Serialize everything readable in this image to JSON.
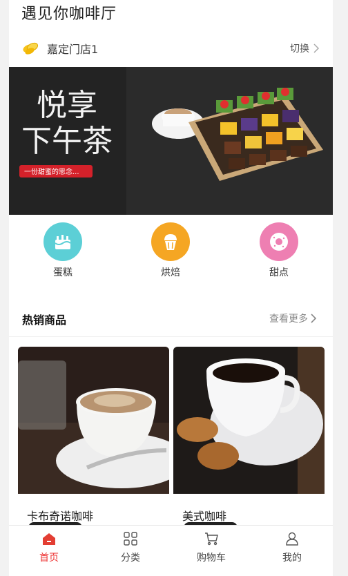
{
  "header": {
    "shop_title": "遇见你咖啡厅"
  },
  "store": {
    "name": "嘉定门店1",
    "switch_label": "切换",
    "icon": "coins-icon"
  },
  "banner": {
    "headline_1": "悦享",
    "headline_2": "下午茶",
    "tagline": "一份甜蜜的思念..."
  },
  "categories": [
    {
      "label": "蛋糕",
      "icon": "cake-icon",
      "color": "#5ccfd6"
    },
    {
      "label": "烘焙",
      "icon": "muffin-icon",
      "color": "#f5a623"
    },
    {
      "label": "甜点",
      "icon": "donut-icon",
      "color": "#ee7fb2"
    }
  ],
  "hot": {
    "title": "热销商品",
    "more_label": "查看更多"
  },
  "products": [
    {
      "name": "卡布奇诺咖啡"
    },
    {
      "name": "美式咖啡"
    }
  ],
  "tabbar": {
    "items": [
      {
        "label": "首页",
        "icon": "home-icon",
        "active": true
      },
      {
        "label": "分类",
        "icon": "grid-icon",
        "active": false
      },
      {
        "label": "购物车",
        "icon": "cart-icon",
        "active": false
      },
      {
        "label": "我的",
        "icon": "user-icon",
        "active": false
      }
    ],
    "active_color": "#e33e33"
  }
}
